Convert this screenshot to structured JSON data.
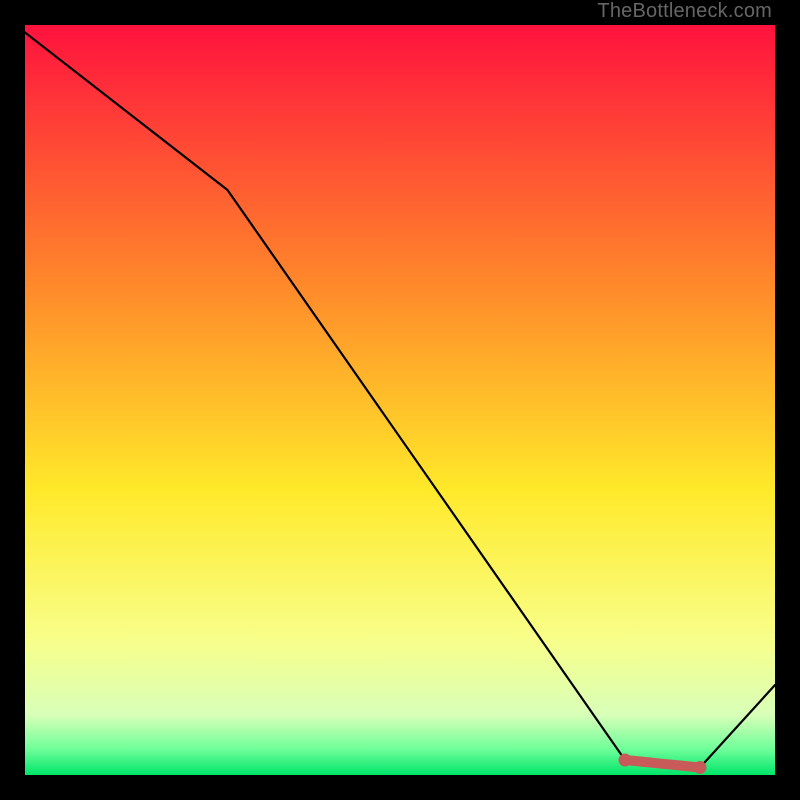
{
  "watermark": "TheBottleneck.com",
  "colors": {
    "gradient_top": "#ff123e",
    "gradient_upper_mid": "#ff8a2a",
    "gradient_mid": "#ffe92a",
    "gradient_lower_mid": "#f8ff8a",
    "gradient_band": "#b8ffb0",
    "gradient_bottom": "#00e56a",
    "line": "#000000",
    "frame": "#000000",
    "marker": "#c85a5a"
  },
  "chart_data": {
    "type": "line",
    "title": "",
    "xlabel": "",
    "ylabel": "",
    "xlim": [
      0,
      100
    ],
    "ylim": [
      0,
      100
    ],
    "x": [
      0,
      27,
      80,
      90,
      100
    ],
    "values": [
      99,
      78,
      2,
      1,
      12
    ],
    "highlight_segment": {
      "x": [
        80,
        90
      ],
      "values": [
        2,
        1
      ]
    },
    "background_gradient": {
      "stops": [
        {
          "offset": 0.0,
          "color": "#ff123e"
        },
        {
          "offset": 0.35,
          "color": "#ff8a2a"
        },
        {
          "offset": 0.62,
          "color": "#ffe92a"
        },
        {
          "offset": 0.82,
          "color": "#f8ff8a"
        },
        {
          "offset": 0.92,
          "color": "#d8ffb8"
        },
        {
          "offset": 0.965,
          "color": "#70ff9a"
        },
        {
          "offset": 1.0,
          "color": "#00e56a"
        }
      ]
    }
  }
}
